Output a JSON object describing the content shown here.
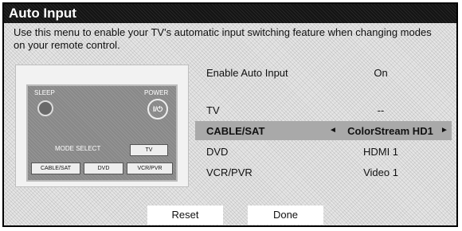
{
  "dialog": {
    "title": "Auto Input",
    "description": "Use this menu to enable your TV's automatic input switching feature when changing modes on your remote control."
  },
  "remote": {
    "sleep_label": "SLEEP",
    "power_label": "POWER",
    "power_glyph": "I/⏻",
    "mode_select_label": "MODE SELECT",
    "buttons": [
      "TV",
      "CABLE/SAT",
      "DVD",
      "VCR/PVR"
    ]
  },
  "settings": [
    {
      "label": "Enable Auto Input",
      "value": "On"
    },
    {
      "label": "TV",
      "value": "--"
    },
    {
      "label": "CABLE/SAT",
      "value": "ColorStream HD1",
      "selected": true
    },
    {
      "label": "DVD",
      "value": "HDMI 1"
    },
    {
      "label": "VCR/PVR",
      "value": "Video 1"
    }
  ],
  "selector": {
    "left_arrow": "◄",
    "right_arrow": "►"
  },
  "actions": {
    "reset_label": "Reset",
    "done_label": "Done"
  }
}
